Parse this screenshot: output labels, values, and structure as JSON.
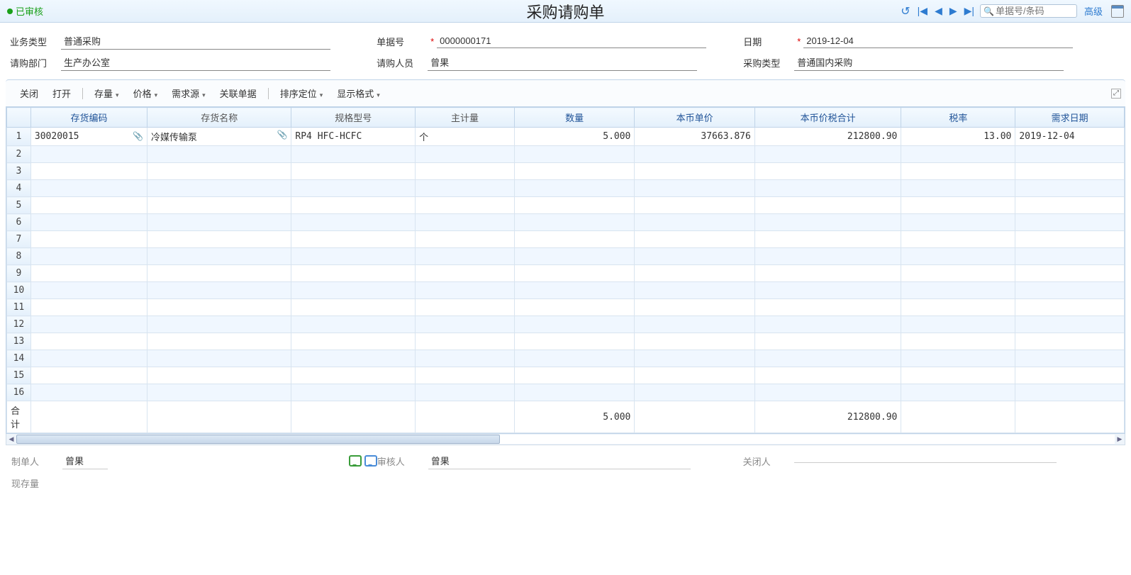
{
  "status": {
    "text": "已审核"
  },
  "title": "采购请购单",
  "search": {
    "placeholder": "单据号/条码"
  },
  "advanced": "高级",
  "fields": {
    "biz_type": {
      "label": "业务类型",
      "value": "普通采购"
    },
    "doc_no": {
      "label": "单据号",
      "value": "0000000171",
      "required": true
    },
    "date": {
      "label": "日期",
      "value": "2019-12-04",
      "required": true
    },
    "dept": {
      "label": "请购部门",
      "value": "生产办公室"
    },
    "person": {
      "label": "请购人员",
      "value": "曾果"
    },
    "ptype": {
      "label": "采购类型",
      "value": "普通国内采购"
    }
  },
  "toolbar": {
    "close": "关闭",
    "open": "打开",
    "stock": "存量",
    "price": "价格",
    "source": "需求源",
    "related": "关联单据",
    "sort": "排序定位",
    "display": "显示格式"
  },
  "grid": {
    "cols": {
      "code": "存货编码",
      "name": "存货名称",
      "spec": "规格型号",
      "uom": "主计量",
      "qty": "数量",
      "price": "本币单价",
      "amount": "本币价税合计",
      "tax": "税率",
      "need": "需求日期"
    },
    "row1": {
      "code": "30020015",
      "name": "冷媒传输泵",
      "spec": "RP4 HFC-HCFC",
      "uom": "个",
      "qty": "5.000",
      "price": "37663.876",
      "amount": "212800.90",
      "tax": "13.00",
      "need": "2019-12-04"
    },
    "total": {
      "label": "合计",
      "qty": "5.000",
      "amount": "212800.90"
    }
  },
  "footer": {
    "maker": {
      "label": "制单人",
      "value": "曾果"
    },
    "auditor": {
      "label": "审核人",
      "value": "曾果"
    },
    "closer": {
      "label": "关闭人",
      "value": ""
    },
    "stock": {
      "label": "现存量",
      "value": ""
    }
  }
}
